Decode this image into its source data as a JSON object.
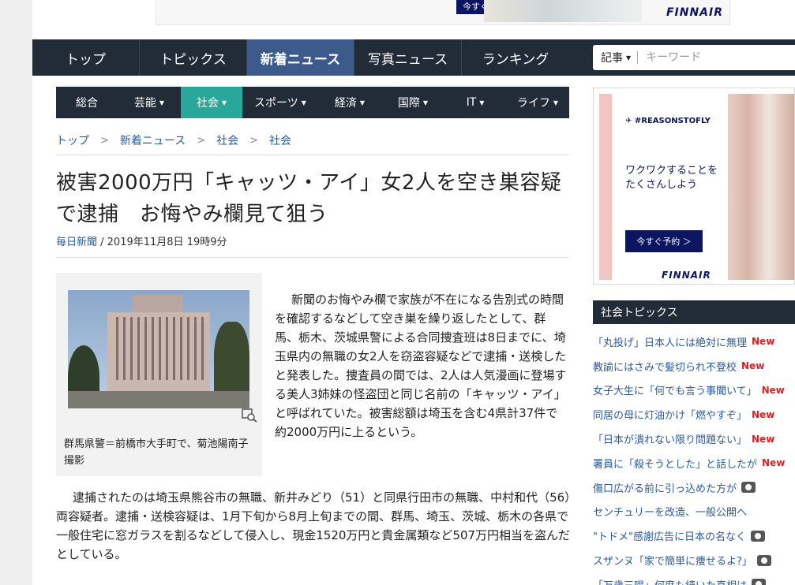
{
  "top_ad": {
    "cta": "今すぐ予約 ＞",
    "brand": "FINNAIR"
  },
  "main_nav": {
    "tabs": [
      {
        "label": "トップ",
        "active": false
      },
      {
        "label": "トピックス",
        "active": false
      },
      {
        "label": "新着ニュース",
        "active": true
      },
      {
        "label": "写真ニュース",
        "active": false
      },
      {
        "label": "ランキング",
        "active": false
      }
    ]
  },
  "search": {
    "scope": "記事",
    "placeholder": "キーワード"
  },
  "sub_nav": {
    "tabs": [
      {
        "label": "総合",
        "caret": false,
        "active": false
      },
      {
        "label": "芸能",
        "caret": true,
        "active": false
      },
      {
        "label": "社会",
        "caret": true,
        "active": true
      },
      {
        "label": "スポーツ",
        "caret": true,
        "active": false
      },
      {
        "label": "経済",
        "caret": true,
        "active": false
      },
      {
        "label": "国際",
        "caret": true,
        "active": false
      },
      {
        "label": "IT",
        "caret": true,
        "active": false
      },
      {
        "label": "ライフ",
        "caret": true,
        "active": false
      }
    ]
  },
  "breadcrumb": [
    "トップ",
    "新着ニュース",
    "社会",
    "社会"
  ],
  "article": {
    "title": "被害2000万円「キャッツ・アイ」女2人を空き巣容疑で逮捕　お悔やみ欄見て狙う",
    "source": "毎日新聞",
    "date": " / 2019年11月8日 19時9分",
    "caption": "群馬県警＝前橋市大手町で、菊池陽南子撮影",
    "paragraph1": "新聞のお悔やみ欄で家族が不在になる告別式の時間を確認するなどして空き巣を繰り返したとして、群馬、栃木、茨城県警による合同捜査班は8日までに、埼玉県内の無職の女2人を窃盗容疑などで逮捕・送検したと発表した。捜査員の間では、2人は人気漫画に登場する美人3姉妹の怪盗団と同じ名前の「キャッツ・アイ」と呼ばれていた。被害総額は埼玉を含む4県計37件で約2000万円に上るという。",
    "paragraph2": "逮捕されたのは埼玉県熊谷市の無職、新井みどり（51）と同県行田市の無職、中村和代（56）両容疑者。逮捕・送検容疑は、1月下旬から8月上旬までの間、群馬、埼玉、茨城、栃木の各県で一般住宅に窓ガラスを割るなどして侵入し、現金1520万円と貴金属類など507万円相当を盗んだとしている。"
  },
  "side_ad": {
    "tag": "✈ #REASONSTOFLY",
    "copy": "ワクワクすることを たくさんしよう",
    "cta": "今すぐ予約 ＞",
    "brand": "FINNAIR"
  },
  "sidebar": {
    "heading": "社会トピックス",
    "topics": [
      {
        "text": "「丸投げ」日本人には絶対に無理",
        "badge": "New"
      },
      {
        "text": "教諭にはさみで髪切られ不登校",
        "badge": "New"
      },
      {
        "text": "女子大生に「何でも言う事聞いて」",
        "badge": "New"
      },
      {
        "text": "同居の母に灯油かけ「燃やすぞ」",
        "badge": "New"
      },
      {
        "text": "「日本が潰れない限り問題ない」",
        "badge": "New"
      },
      {
        "text": "署員に「殺そうとした」と話したが",
        "badge": "New"
      },
      {
        "text": "傷口広がる前に引っ込めた方が",
        "badge": "camera"
      },
      {
        "text": "センチュリーを改造、一般公開へ",
        "badge": ""
      },
      {
        "text": "\"トドメ\"感謝広告に日本の名なく",
        "badge": "camera"
      },
      {
        "text": "スザンヌ「家で簡単に痩せるよ?」",
        "badge": "camera"
      },
      {
        "text": "「万歳三唱」何度も続いた真相は",
        "badge": "camera"
      }
    ]
  },
  "colors": {
    "nav_bg": "#222b38",
    "active_main": "#3d5a8c",
    "active_sub": "#2aa79b",
    "link": "#2b5a9e",
    "new_badge": "#e02020"
  }
}
